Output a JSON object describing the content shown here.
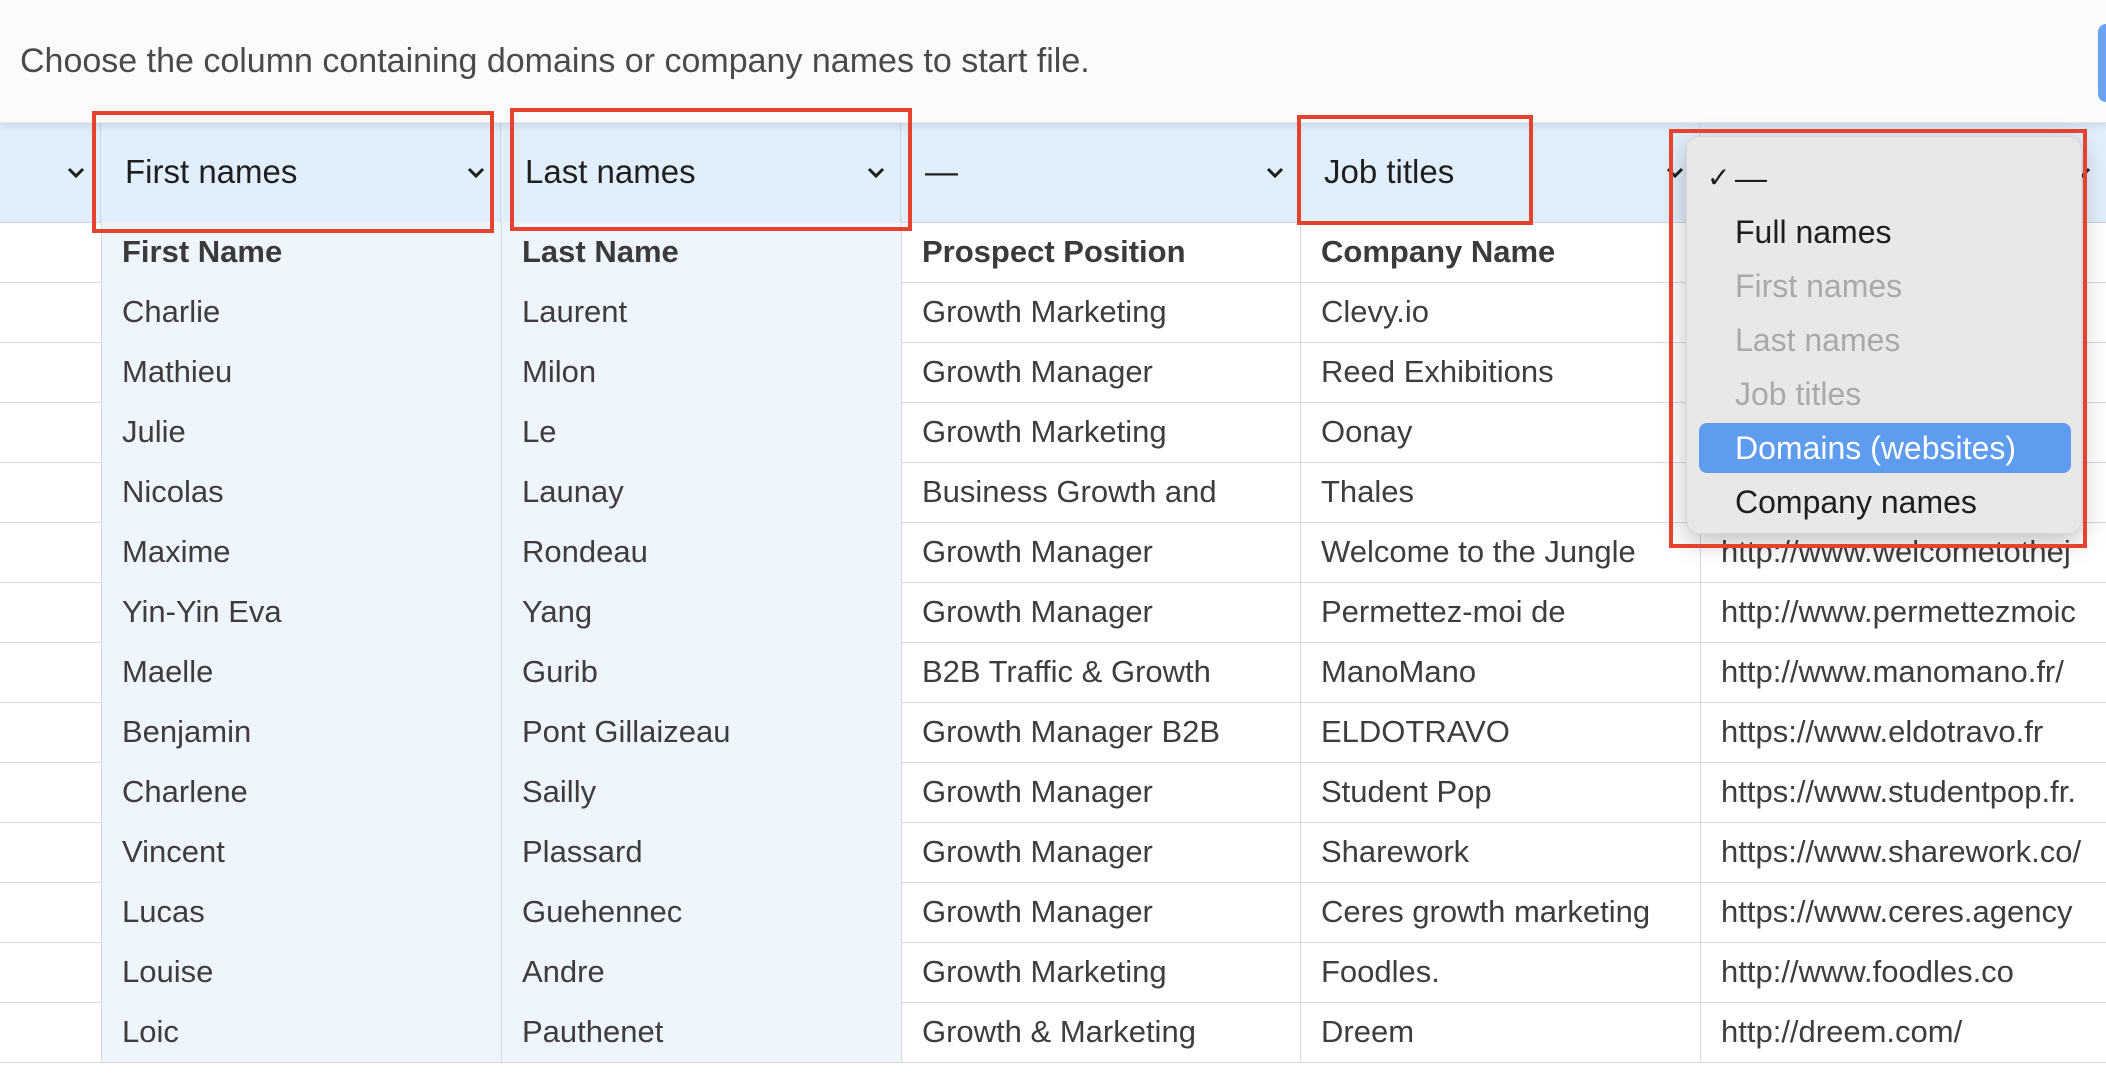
{
  "instruction": "Choose the column containing domains or company names to start file.",
  "mapping": {
    "col1": "First names",
    "col2": "Last names",
    "col3": "—",
    "col4": "Job titles"
  },
  "dropdown": {
    "items": [
      {
        "label": "—",
        "checked": true,
        "state": "normal"
      },
      {
        "label": "Full names",
        "state": "normal"
      },
      {
        "label": "First names",
        "state": "disabled"
      },
      {
        "label": "Last names",
        "state": "disabled"
      },
      {
        "label": "Job titles",
        "state": "disabled"
      },
      {
        "label": "Domains (websites)",
        "state": "selected"
      },
      {
        "label": "Company names",
        "state": "normal"
      }
    ],
    "check_mark": "✓"
  },
  "table": {
    "headers": [
      "First Name",
      "Last Name",
      "Prospect Position",
      "Company Name",
      ""
    ],
    "rows": [
      [
        "Charlie",
        "Laurent",
        "Growth Marketing",
        "Clevy.io",
        ""
      ],
      [
        "Mathieu",
        "Milon",
        "Growth Manager",
        "Reed Exhibitions",
        ""
      ],
      [
        "Julie",
        "Le",
        "Growth Marketing",
        "Oonay",
        ""
      ],
      [
        "Nicolas",
        "Launay",
        "Business Growth and",
        "Thales",
        ""
      ],
      [
        "Maxime",
        "Rondeau",
        "Growth Manager",
        "Welcome to the Jungle",
        "http://www.welcometothej"
      ],
      [
        "Yin-Yin Eva",
        "Yang",
        "Growth Manager",
        "Permettez-moi de",
        "http://www.permettezmoic"
      ],
      [
        "Maelle",
        "Gurib",
        "B2B Traffic & Growth",
        "ManoMano",
        "http://www.manomano.fr/"
      ],
      [
        "Benjamin",
        "Pont Gillaizeau",
        "Growth Manager B2B",
        "ELDOTRAVO",
        "https://www.eldotravo.fr"
      ],
      [
        "Charlene",
        "Sailly",
        "Growth Manager",
        "Student Pop",
        "https://www.studentpop.fr."
      ],
      [
        "Vincent",
        "Plassard",
        "Growth Manager",
        "Sharework",
        "https://www.sharework.co/"
      ],
      [
        "Lucas",
        "Guehennec",
        "Growth Manager",
        "Ceres growth marketing",
        "https://www.ceres.agency"
      ],
      [
        "Louise",
        "Andre",
        "Growth Marketing",
        "Foodles.",
        "http://www.foodles.co"
      ],
      [
        "Loic",
        "Pauthenet",
        "Growth & Marketing",
        "Dreem",
        "http://dreem.com/"
      ]
    ]
  },
  "colors": {
    "highlight": "#e5432f",
    "selected_item": "#5e9cf0",
    "mapping_row": "#e1eefb"
  }
}
